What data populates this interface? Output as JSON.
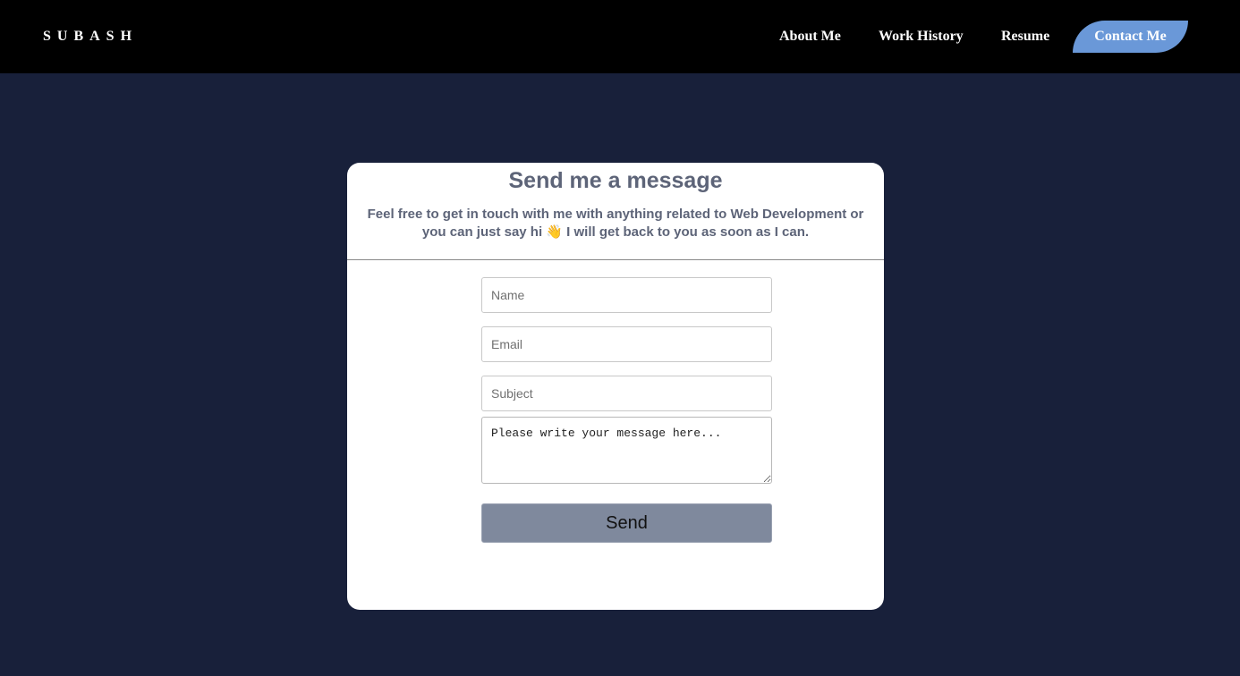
{
  "navbar": {
    "brand": "SUBASH",
    "links": [
      {
        "label": "About Me"
      },
      {
        "label": "Work History"
      },
      {
        "label": "Resume"
      }
    ],
    "contact_label": "Contact Me",
    "contact_color": "#6a98d8"
  },
  "contact": {
    "title": "Send me a message",
    "subtitle": "Feel free to get in touch with me with anything related to Web Development or you can just say hi 👋 I will get back to you as soon as I can.",
    "name_placeholder": "Name",
    "email_placeholder": "Email",
    "subject_placeholder": "Subject",
    "message_placeholder": "Please write your message here...",
    "send_label": "Send",
    "send_color": "#7f899d"
  },
  "colors": {
    "page_background": "#18203a",
    "navbar_background": "#000000",
    "text_muted": "#5d6478"
  }
}
